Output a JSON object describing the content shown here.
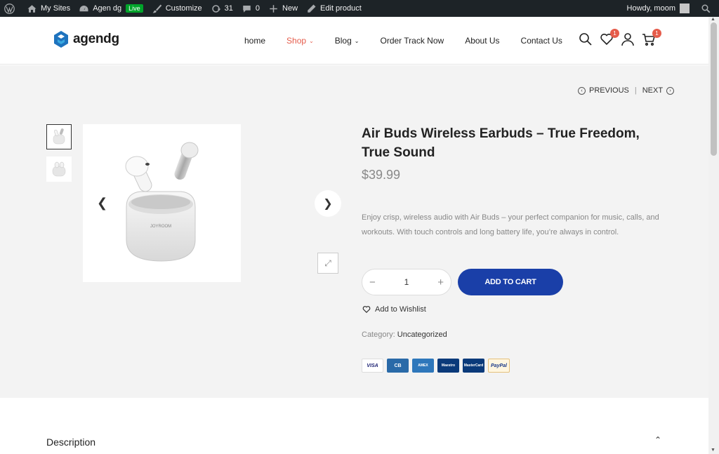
{
  "adminbar": {
    "my_sites": "My Sites",
    "site_name": "Agen dg",
    "live": "Live",
    "customize": "Customize",
    "updates_count": "31",
    "comments_count": "0",
    "new": "New",
    "edit_product": "Edit product",
    "howdy": "Howdy, moom"
  },
  "header": {
    "logo_text": "agendg",
    "nav": [
      "home",
      "Shop",
      "Blog",
      "Order Track Now",
      "About Us",
      "Contact Us"
    ],
    "wishlist_count": "1",
    "cart_count": "1"
  },
  "product_nav": {
    "previous": "PREVIOUS",
    "next": "NEXT"
  },
  "product": {
    "title": "Air Buds Wireless Earbuds – True Freedom, True Sound",
    "price": "$39.99",
    "description": "Enjoy crisp, wireless audio with Air Buds – your perfect companion for music, calls, and workouts. With touch controls and long battery life, you’re always in control.",
    "quantity": "1",
    "add_to_cart": "ADD TO CART",
    "wishlist": "Add to Wishlist",
    "category_label": "Category:",
    "category_value": "Uncategorized",
    "case_brand": "JOYROOM"
  },
  "payments": [
    "VISA",
    "CB",
    "AMEX",
    "Maestro",
    "MasterCard",
    "PayPal"
  ],
  "tabs": {
    "description": "Description"
  },
  "colors": {
    "accent": "#e55c4b",
    "button": "#1a3fa8",
    "admin_bar": "#1d2327"
  }
}
